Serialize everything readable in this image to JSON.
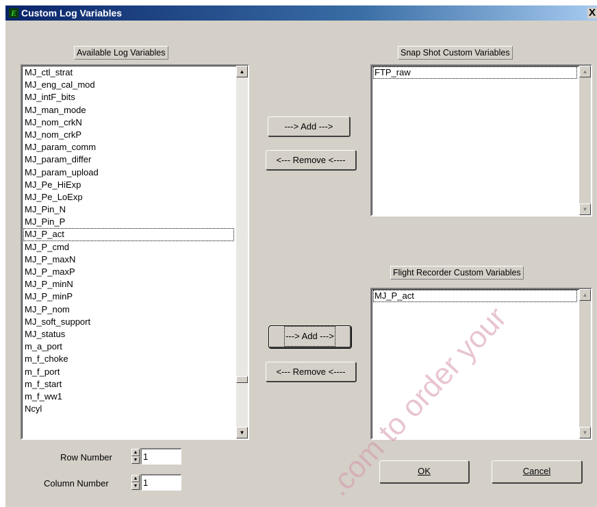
{
  "window": {
    "title": "Custom Log Variables",
    "close_glyph": "X",
    "icon": "app-logo-icon"
  },
  "available": {
    "label": "Available Log Variables",
    "items": [
      "MJ_ctl_strat",
      "MJ_eng_cal_mod",
      "MJ_intF_bits",
      "MJ_man_mode",
      "MJ_nom_crkN",
      "MJ_nom_crkP",
      "MJ_param_comm",
      "MJ_param_differ",
      "MJ_param_upload",
      "MJ_Pe_HiExp",
      "MJ_Pe_LoExp",
      "MJ_Pin_N",
      "MJ_Pin_P",
      "MJ_P_act",
      "MJ_P_cmd",
      "MJ_P_maxN",
      "MJ_P_maxP",
      "MJ_P_minN",
      "MJ_P_minP",
      "MJ_P_nom",
      "MJ_soft_support",
      "MJ_status",
      "m_a_port",
      "m_f_choke",
      "m_f_port",
      "m_f_start",
      "m_f_ww1",
      "Ncyl"
    ],
    "focused_item": "MJ_P_act",
    "scroll_position": 0.88
  },
  "snapshot": {
    "label": "Snap Shot Custom Variables",
    "items": [
      "FTP_raw"
    ],
    "add_label": "---> Add --->",
    "remove_label": "<--- Remove <----"
  },
  "flight": {
    "label": "Flight Recorder Custom Variables",
    "items": [
      "MJ_P_act"
    ],
    "add_label": "---> Add --->",
    "remove_label": "<--- Remove <----"
  },
  "row_number": {
    "label": "Row Number",
    "value": "1"
  },
  "column_number": {
    "label": "Column Number",
    "value": "1"
  },
  "buttons": {
    "ok": "OK",
    "cancel": "Cancel"
  },
  "watermark": {
    "text": ".com to order your"
  },
  "colors": {
    "titlebar_start": "#0a246a",
    "titlebar_end": "#a6caf0",
    "face": "#d4d0c8"
  },
  "icons": {
    "up_arrow": "▲",
    "down_arrow": "▼",
    "spin_up": "▲",
    "spin_down": "▼"
  }
}
